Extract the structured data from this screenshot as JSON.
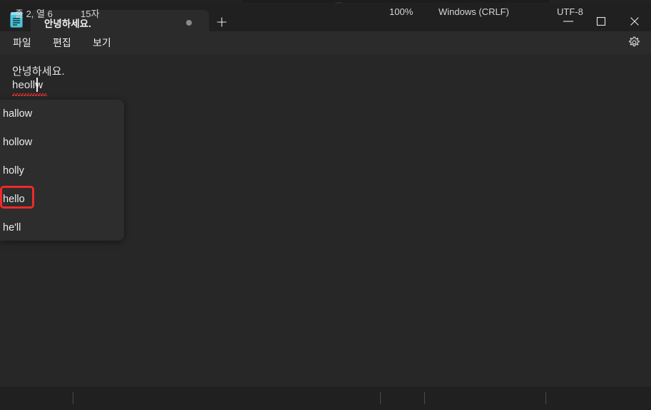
{
  "window": {
    "title_bar": {
      "app_icon": "notepad-icon",
      "tab": {
        "label": "안녕하세요.",
        "modified_indicator": "•"
      },
      "new_tab_label": "+",
      "controls": {
        "minimize": "minimize-icon",
        "maximize": "maximize-icon",
        "close": "close-icon"
      }
    },
    "menubar": {
      "items": [
        {
          "label": "파일"
        },
        {
          "label": "편집"
        },
        {
          "label": "보기"
        }
      ],
      "settings_icon": "gear-icon"
    }
  },
  "editor": {
    "lines": [
      "안녕하세요.",
      "heollw"
    ],
    "misspelled_word": "heollw",
    "cursor": {
      "line": 2,
      "column": 6
    }
  },
  "suggestions": {
    "items": [
      {
        "label": "hallow",
        "highlighted": false
      },
      {
        "label": "hollow",
        "highlighted": false
      },
      {
        "label": "holly",
        "highlighted": false
      },
      {
        "label": "hello",
        "highlighted": true
      },
      {
        "label": "he'll",
        "highlighted": false
      }
    ],
    "highlight_color": "#ee2a2a"
  },
  "statusbar": {
    "line_col": "줄 2, 열 6",
    "char_count": "15자",
    "zoom": "100%",
    "line_ending": "Windows (CRLF)",
    "encoding": "UTF-8"
  },
  "colors": {
    "titlebar_bg": "#202020",
    "menubar_bg": "#2b2b2b",
    "editor_bg": "#272727",
    "dropdown_bg": "#2d2d2d",
    "accent_red": "#ee2a2a"
  }
}
